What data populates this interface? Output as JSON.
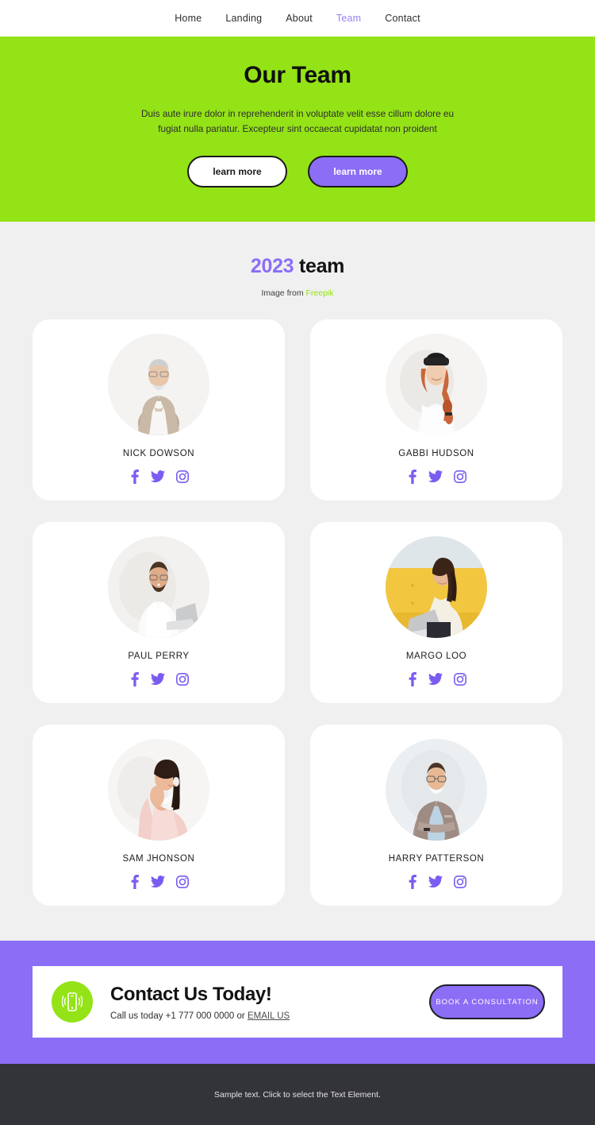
{
  "nav": {
    "items": [
      {
        "label": "Home",
        "active": false
      },
      {
        "label": "Landing",
        "active": false
      },
      {
        "label": "About",
        "active": false
      },
      {
        "label": "Team",
        "active": true
      },
      {
        "label": "Contact",
        "active": false
      }
    ]
  },
  "hero": {
    "title": "Our Team",
    "subtitle": "Duis aute irure dolor in reprehenderit in voluptate velit esse cillum dolore eu fugiat nulla pariatur. Excepteur sint occaecat cupidatat non proident",
    "button_primary": "learn more",
    "button_secondary": "learn more",
    "background_color": "#94e316"
  },
  "team": {
    "heading_year": "2023",
    "heading_word": "team",
    "credit_prefix": "Image from",
    "credit_link": "Freepik",
    "social_icons": [
      "facebook-icon",
      "twitter-icon",
      "instagram-icon"
    ],
    "social_color": "#7b5cf0",
    "members": [
      {
        "name": "NICK DOWSON",
        "photo": "older-man-beige-suit"
      },
      {
        "name": "GABBI HUDSON",
        "photo": "woman-black-beanie-red-braid"
      },
      {
        "name": "PAUL PERRY",
        "photo": "man-white-shirt-laptop"
      },
      {
        "name": "MARGO LOO",
        "photo": "woman-yellow-chair-laptop"
      },
      {
        "name": "SAM JHONSON",
        "photo": "woman-pink-hoodie-laughing"
      },
      {
        "name": "HARRY PATTERSON",
        "photo": "man-glasses-grey-blazer"
      }
    ]
  },
  "cta": {
    "icon": "vibrating-phone-icon",
    "title": "Contact Us Today!",
    "sub_prefix": "Call us today +1 777 000 0000 or",
    "sub_link": "EMAIL US",
    "button": "BOOK A CONSULTATION",
    "background_color": "#8b6df6",
    "badge_color": "#94e316"
  },
  "footer": {
    "text": "Sample text. Click to select the Text Element.",
    "background_color": "#33333a"
  }
}
